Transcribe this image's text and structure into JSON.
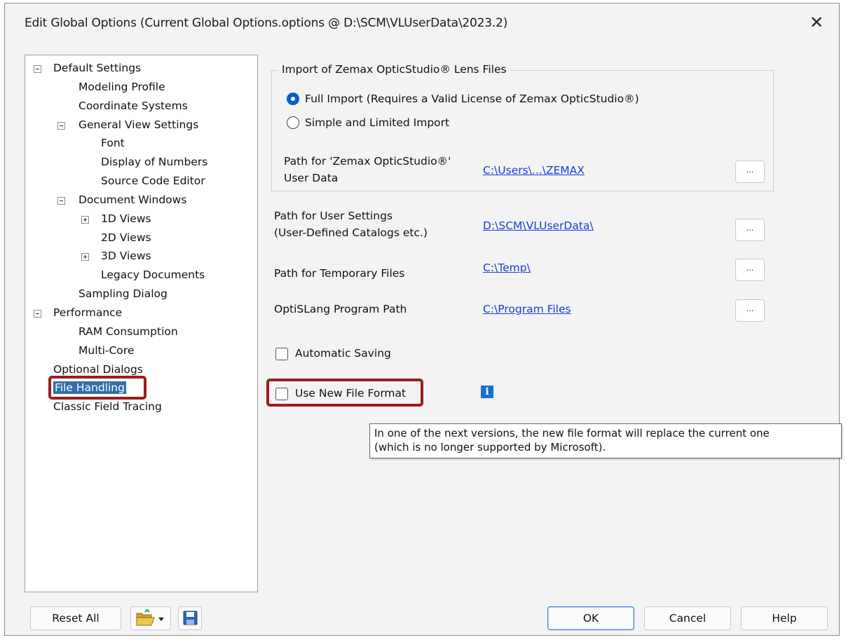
{
  "window": {
    "title": "Edit Global Options (Current Global Options.options @ D:\\SCM\\VLUserData\\2023.2)",
    "close_glyph": "✕"
  },
  "tree": {
    "items": [
      {
        "label": "Default Settings",
        "toggle": "minus"
      },
      {
        "label": "Modeling Profile"
      },
      {
        "label": "Coordinate Systems"
      },
      {
        "label": "General View Settings",
        "toggle": "minus"
      },
      {
        "label": "Font"
      },
      {
        "label": "Display of Numbers"
      },
      {
        "label": "Source Code Editor"
      },
      {
        "label": "Document Windows",
        "toggle": "minus"
      },
      {
        "label": "1D Views",
        "toggle": "plus"
      },
      {
        "label": "2D Views"
      },
      {
        "label": "3D Views",
        "toggle": "plus"
      },
      {
        "label": "Legacy Documents"
      },
      {
        "label": "Sampling Dialog"
      },
      {
        "label": "Performance",
        "toggle": "minus"
      },
      {
        "label": "RAM Consumption"
      },
      {
        "label": "Multi-Core"
      },
      {
        "label": "Optional Dialogs"
      },
      {
        "label": "File Handling",
        "selected": true
      },
      {
        "label": "Classic Field Tracing"
      }
    ]
  },
  "zemax_group": {
    "legend": "Import of Zemax OpticStudio® Lens Files",
    "full_import": "Full Import (Requires a Valid License of Zemax OpticStudio®)",
    "simple_import": "Simple and Limited Import",
    "path_label_1": "Path for 'Zemax OpticStudio®'",
    "path_label_2": "User Data",
    "path_value": "C:\\Users\\...\\ZEMAX"
  },
  "paths": {
    "user_settings_label_1": "Path for User Settings",
    "user_settings_label_2": "(User-Defined Catalogs etc.)",
    "user_settings_value": "D:\\SCM\\VLUserData\\",
    "temp_label": "Path for Temporary Files",
    "temp_value": "C:\\Temp\\",
    "optislang_label": "OptiSLang Program Path",
    "optislang_value": "C:\\Program Files",
    "browse_label": "..."
  },
  "options": {
    "automatic_saving": "Automatic Saving",
    "use_new_file_format": "Use New File Format",
    "info_glyph": "i"
  },
  "tooltip": {
    "line1": "In one of the next versions, the new file format will replace the current one",
    "line2": "(which is no longer supported by Microsoft)."
  },
  "buttons": {
    "reset_all": "Reset All",
    "ok": "OK",
    "cancel": "Cancel",
    "help": "Help"
  },
  "colors": {
    "highlight": "#9a1c1f",
    "selection": "#2d6fa9",
    "link": "#1a3cd6",
    "radio_on": "#0a5ec9"
  }
}
